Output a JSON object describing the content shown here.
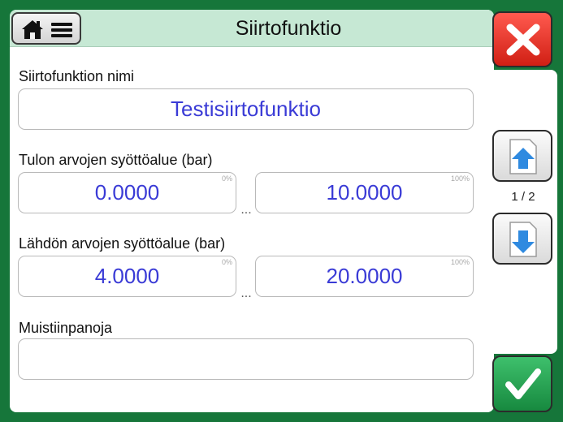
{
  "header": {
    "title": "Siirtofunktio",
    "home_icon": "home-icon",
    "menu_icon": "menu-icon"
  },
  "form": {
    "name_label": "Siirtofunktion nimi",
    "name_value": "Testisiirtofunktio",
    "input_label": "Tulon arvojen syöttöalue (bar)",
    "input_min": "0.0000",
    "input_max": "10.0000",
    "output_label": "Lähdön arvojen syöttöalue (bar)",
    "output_min": "4.0000",
    "output_max": "20.0000",
    "pct_min": "0%",
    "pct_max": "100%",
    "range_sep": "...",
    "notes_label": "Muistiinpanoja",
    "notes_value": ""
  },
  "side": {
    "page_indicator": "1 / 2",
    "close_icon": "close-icon",
    "ok_icon": "checkmark-icon",
    "up_icon": "page-up-icon",
    "down_icon": "page-down-icon"
  },
  "colors": {
    "frame": "#16763a",
    "header": "#c6e8d4",
    "value_text": "#3a3bd6",
    "close": "#e0291d",
    "ok": "#22a050"
  }
}
